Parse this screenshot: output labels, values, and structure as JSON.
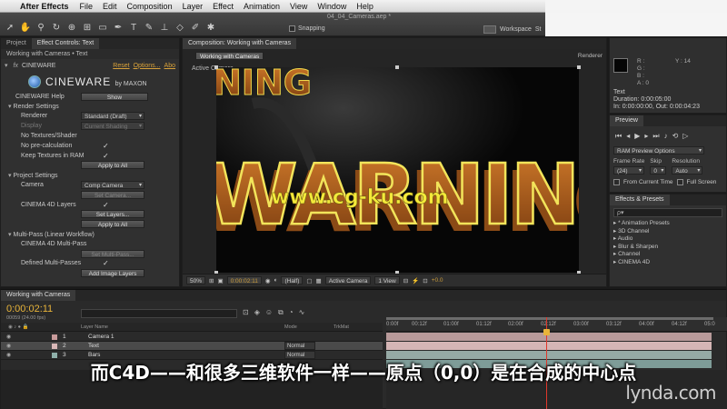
{
  "menubar": {
    "app": "After Effects",
    "items": [
      "File",
      "Edit",
      "Composition",
      "Layer",
      "Effect",
      "Animation",
      "View",
      "Window",
      "Help"
    ]
  },
  "toolbar": {
    "doc_title": "04_04_Cameras.aep *",
    "snapping_label": "Snapping",
    "workspace_label": "Workspace",
    "workspace_value": "St"
  },
  "effect_controls": {
    "tabs": [
      "Project",
      "Effect Controls: Text"
    ],
    "subtitle": "Working with Cameras • Text",
    "fx_name": "CINEWARE",
    "reset": "Reset",
    "options": "Options...",
    "about": "Abo",
    "logo_main": "CINEWARE",
    "logo_sub": "by MAXON",
    "help_label": "CINEWARE Help",
    "show_btn": "Show",
    "render_settings": "Render Settings",
    "renderer_label": "Renderer",
    "renderer_value": "Standard (Draft)",
    "display_label": "Display",
    "display_value": "Current Shading",
    "no_textures": "No Textures/Shader",
    "no_precalc": "No pre-calculation",
    "keep_textures": "Keep Textures in RAM",
    "apply_all_1": "Apply to All",
    "project_settings": "Project Settings",
    "camera_label": "Camera",
    "camera_value": "Comp Camera",
    "set_camera": "Set Camera...",
    "c4d_layers_label": "CINEMA 4D Layers",
    "set_layers": "Set Layers...",
    "apply_all_2": "Apply to All",
    "multipass": "Multi-Pass (Linear Workflow)",
    "c4d_multipass": "CINEMA 4D Multi-Pass",
    "set_multipass": "Set Multi-Pass...",
    "defined_multipass": "Defined Multi-Passes",
    "add_image_layers": "Add Image Layers"
  },
  "composition": {
    "tab": "Composition: Working with Cameras",
    "crumb": "Working with Cameras",
    "renderer": "Renderer",
    "active_camera": "Active Camera",
    "canvas_text": "WARNING",
    "top_text": "NING",
    "watermark": "www.cg-ku.com",
    "zoom": "50%",
    "timecode": "0:00:02:11",
    "resolution": "(Half)",
    "view_camera": "Active Camera",
    "views": "1 View",
    "offset": "+0.0"
  },
  "info": {
    "y_label": "Y : 14",
    "nums": [
      "R :",
      "G :",
      "B :",
      "A : 0"
    ],
    "layer_name": "Text",
    "duration": "Duration: 0:00:05:00",
    "in_out": "In: 0:00:00:00, Out: 0:00:04:23"
  },
  "preview": {
    "tab": "Preview",
    "ram_options": "RAM Preview Options",
    "frame_rate_label": "Frame Rate",
    "skip_label": "Skip",
    "resolution_label": "Resolution",
    "frame_rate_value": "(24)",
    "skip_value": "0",
    "resolution_value": "Auto",
    "from_current": "From Current Time",
    "full_screen": "Full Screen"
  },
  "effects_presets": {
    "tab": "Effects & Presets",
    "search_placeholder": "ρ▾",
    "items": [
      "* Animation Presets",
      "3D Channel",
      "Audio",
      "Blur & Sharpen",
      "Channel",
      "CINEMA 4D"
    ]
  },
  "timeline": {
    "tab": "Working with Cameras",
    "timecode": "0:00:02:11",
    "sub_timecode": "00059 (24.00 fps)",
    "col_layer_name": "Layer Name",
    "col_mode": "Mode",
    "col_trkmat": "TrkMat",
    "ticks": [
      "0:00f",
      "00:12f",
      "01:00f",
      "01:12f",
      "02:00f",
      "02:12f",
      "03:00f",
      "03:12f",
      "04:00f",
      "04:12f",
      "05:0"
    ],
    "layers": [
      {
        "num": "1",
        "name": "Camera 1",
        "mode": ""
      },
      {
        "num": "2",
        "name": "Text",
        "mode": "Normal"
      },
      {
        "num": "3",
        "name": "Bars",
        "mode": "Normal"
      }
    ]
  },
  "subtitle": "而C4D——和很多三维软件一样——原点（0,0）是在合成的中心点",
  "lynda": "lynda.com",
  "colors": {
    "accent_orange": "#e8b43a",
    "warning_text": "#e8c84a",
    "playhead": "#e0372b"
  }
}
